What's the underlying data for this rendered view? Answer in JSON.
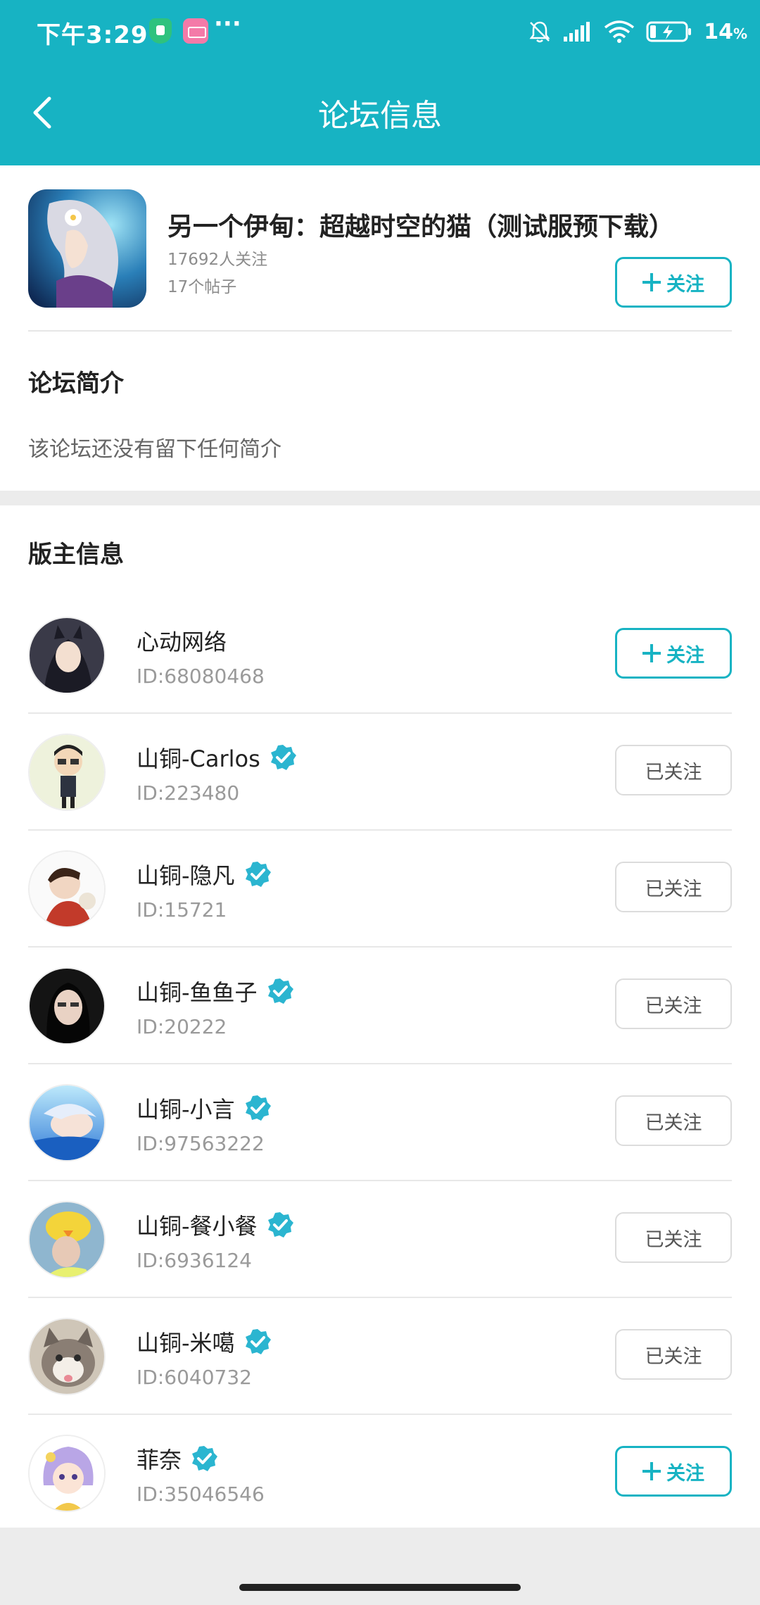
{
  "status_bar": {
    "time": "下午3:29",
    "battery": "14",
    "battery_unit": "%"
  },
  "header": {
    "title": "论坛信息"
  },
  "forum": {
    "name": "另一个伊甸：超越时空的猫（测试服预下载）",
    "followers": "17692人关注",
    "posts": "17个帖子",
    "follow_label": "关注"
  },
  "intro": {
    "title": "论坛简介",
    "text": "该论坛还没有留下任何简介"
  },
  "moderators": {
    "title": "版主信息",
    "follow_label": "关注",
    "following_label": "已关注",
    "items": [
      {
        "name": "心动网络",
        "id": "ID:68080468",
        "verified": false,
        "following": false
      },
      {
        "name": "山铜-Carlos",
        "id": "ID:223480",
        "verified": true,
        "following": true
      },
      {
        "name": "山铜-隐凡",
        "id": "ID:15721",
        "verified": true,
        "following": true
      },
      {
        "name": "山铜-鱼鱼子",
        "id": "ID:20222",
        "verified": true,
        "following": true
      },
      {
        "name": "山铜-小言",
        "id": "ID:97563222",
        "verified": true,
        "following": true
      },
      {
        "name": "山铜-餐小餐",
        "id": "ID:6936124",
        "verified": true,
        "following": true
      },
      {
        "name": "山铜-米噶",
        "id": "ID:6040732",
        "verified": true,
        "following": true
      },
      {
        "name": "菲奈",
        "id": "ID:35046546",
        "verified": true,
        "following": false
      }
    ]
  },
  "colors": {
    "accent": "#17b3c3",
    "verified": "#2bb5d0"
  }
}
